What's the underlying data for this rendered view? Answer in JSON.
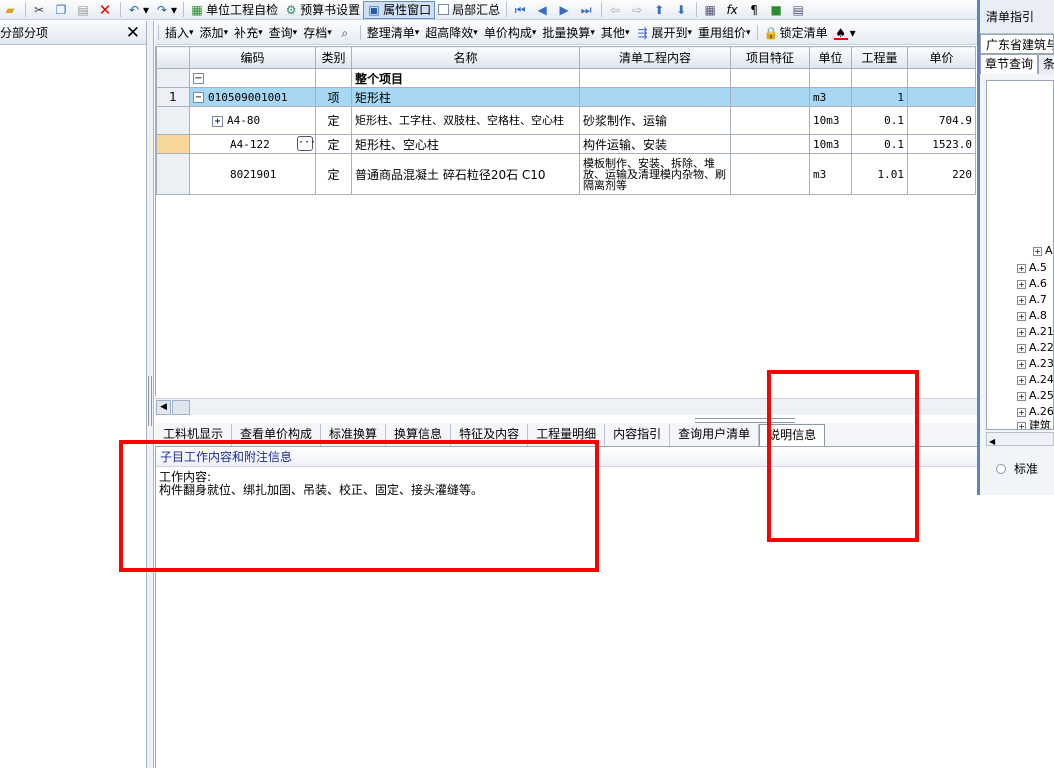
{
  "toolbar1": {
    "buttons": [
      "单位工程自检",
      "预算书设置",
      "属性窗口",
      "局部汇总"
    ]
  },
  "left_panel": {
    "title": "分部分项",
    "close": "✕"
  },
  "toolbar2": {
    "items": [
      "插入",
      "添加",
      "补充",
      "查询",
      "存档",
      "整理清单",
      "超高降效",
      "单价构成",
      "批量换算",
      "其他",
      "展开到",
      "重用组价",
      "锁定清单"
    ]
  },
  "grid": {
    "headers": [
      "编码",
      "类别",
      "名称",
      "清单工程内容",
      "项目特征",
      "单位",
      "工程量",
      "单价"
    ],
    "rows": [
      {
        "rownum": "",
        "code": "",
        "type": "",
        "name": "整个项目",
        "content": "",
        "feature": "",
        "unit": "",
        "qty": "",
        "price": ""
      },
      {
        "rownum": "1",
        "code": "010509001001",
        "type": "项",
        "name": "矩形柱",
        "content": "",
        "feature": "",
        "unit": "m3",
        "qty": "1",
        "price": ""
      },
      {
        "rownum": "",
        "code": "A4-80",
        "type": "定",
        "name": "矩形柱、工字柱、双肢柱、空格柱、空心柱",
        "content": "砂浆制作、运输",
        "feature": "",
        "unit": "10m3",
        "qty": "0.1",
        "price": "704.9"
      },
      {
        "rownum": "",
        "code": "A4-122",
        "type": "定",
        "name": "矩形柱、空心柱",
        "content": "构件运输、安装",
        "feature": "",
        "unit": "10m3",
        "qty": "0.1",
        "price": "1523.0"
      },
      {
        "rownum": "",
        "code": "8021901",
        "type": "定",
        "name": "普通商品混凝土 碎石粒径20石 C10",
        "content": "模板制作、安装、拆除、堆放、运输及清理模内杂物、刷隔离剂等",
        "feature": "",
        "unit": "m3",
        "qty": "1.01",
        "price": "220"
      }
    ]
  },
  "bottom_tabs": [
    "工料机显示",
    "查看单价构成",
    "标准换算",
    "换算信息",
    "特征及内容",
    "工程量明细",
    "内容指引",
    "查询用户清单",
    "说明信息"
  ],
  "detail": {
    "header": "子目工作内容和附注信息",
    "line1": "工作内容:",
    "line2": "构件翻身就位、绑扎加固、吊装、校正、固定、接头灌缝等。"
  },
  "right_panel": {
    "title": "清单指引",
    "province": "广东省建筑与",
    "tab1": "章节查询",
    "tab2": "条",
    "tree": [
      "A",
      "A.5",
      "A.6",
      "A.7",
      "A.8",
      "A.21",
      "A.22",
      "A.23",
      "A.24",
      "A.25",
      "A.26",
      "建筑"
    ],
    "radio": "标准"
  },
  "colors": {
    "highlight_row": "#a7d7f3",
    "annotation": "#ff0000",
    "selected_rowhead": "#f9d79a"
  }
}
